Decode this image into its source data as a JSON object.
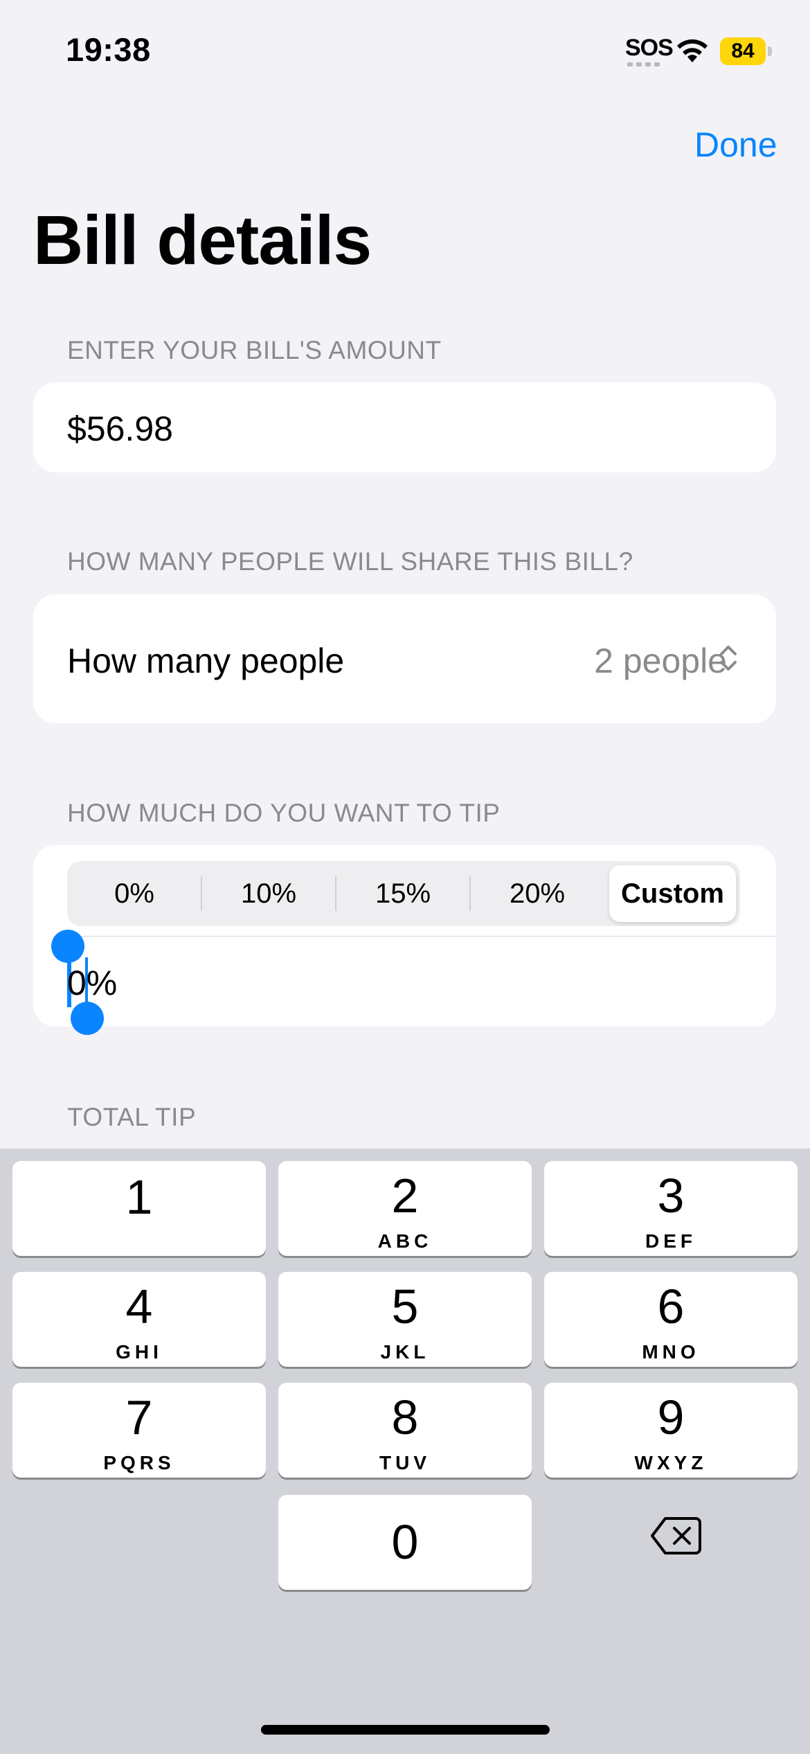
{
  "status_bar": {
    "time": "19:38",
    "sos": "SOS",
    "battery": "84",
    "wifi_icon": "wifi-icon",
    "battery_color": "#ffd60a"
  },
  "nav": {
    "done_label": "Done",
    "title": "Bill details"
  },
  "bill_amount": {
    "section_label": "ENTER YOUR BILL'S AMOUNT",
    "value": "$56.98"
  },
  "people": {
    "section_label": "HOW MANY PEOPLE WILL SHARE THIS BILL?",
    "label": "How many people",
    "value": "2 people",
    "icon": "chevron-up-down-icon"
  },
  "tip": {
    "section_label": "HOW MUCH DO YOU WANT TO TIP",
    "options": [
      "0%",
      "10%",
      "15%",
      "20%",
      "Custom"
    ],
    "selected": "Custom",
    "custom_value": "0%"
  },
  "total_tip": {
    "section_label": "TOTAL TIP"
  },
  "keyboard": {
    "keys": [
      {
        "num": "1",
        "letters": ""
      },
      {
        "num": "2",
        "letters": "ABC"
      },
      {
        "num": "3",
        "letters": "DEF"
      },
      {
        "num": "4",
        "letters": "GHI"
      },
      {
        "num": "5",
        "letters": "JKL"
      },
      {
        "num": "6",
        "letters": "MNO"
      },
      {
        "num": "7",
        "letters": "PQRS"
      },
      {
        "num": "8",
        "letters": "TUV"
      },
      {
        "num": "9",
        "letters": "WXYZ"
      },
      {
        "num": "0",
        "letters": ""
      }
    ],
    "delete_icon": "backspace-icon"
  },
  "colors": {
    "accent": "#0a84ff",
    "background": "#f2f2f7",
    "keyboard_bg": "#d1d3d9"
  }
}
